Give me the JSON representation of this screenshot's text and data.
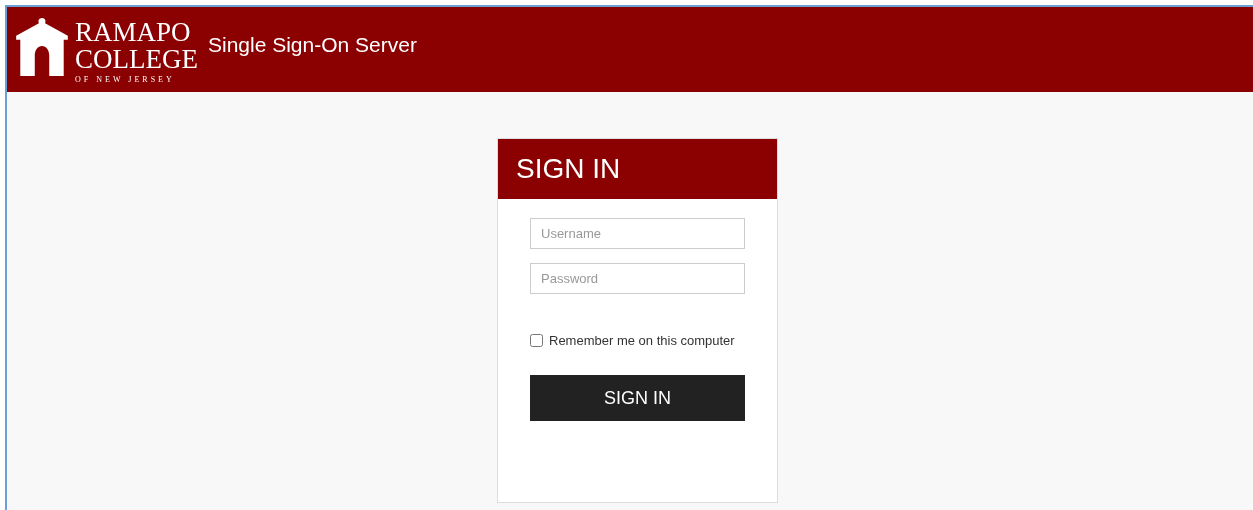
{
  "header": {
    "logo": {
      "line_1": "RAMAPO",
      "line_2": "COLLEGE",
      "line_3": "OF NEW JERSEY"
    },
    "title": "Single Sign-On Server"
  },
  "login": {
    "heading": "SIGN IN",
    "fields": [
      {
        "placeholder": "Username"
      },
      {
        "placeholder": "Password"
      }
    ],
    "remember": {
      "label": "Remember me on this computer",
      "checked": false
    },
    "button": "SIGN IN"
  }
}
